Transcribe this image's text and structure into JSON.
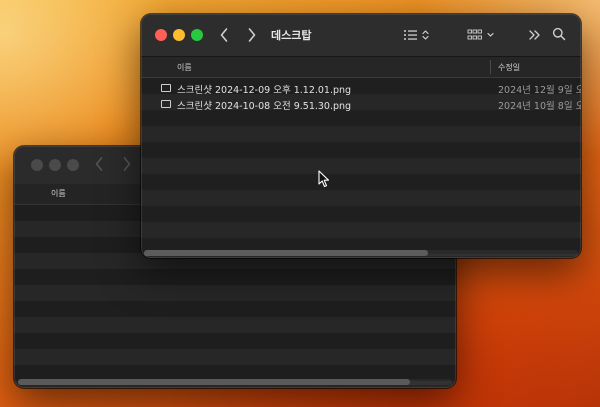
{
  "front_window": {
    "title": "데스크탑",
    "columns": {
      "name": "이름",
      "modified": "수정일"
    },
    "files": [
      {
        "name": "스크린샷 2024-12-09 오후 1.12.01.png",
        "date": "2024년 12월 9일 오"
      },
      {
        "name": "스크린샷 2024-10-08 오전 9.51.30.png",
        "date": "2024년 10월 8일 오"
      }
    ]
  },
  "back_window": {
    "columns": {
      "name": "이름"
    }
  },
  "icons": {
    "back": "chevron-left-icon",
    "forward": "chevron-right-icon",
    "list_view": "list-view-icon",
    "group": "group-view-icon",
    "more": "double-chevron-right-icon",
    "search": "search-icon",
    "cursor": "mouse-pointer-icon"
  },
  "colors": {
    "close": "#ff5f57",
    "minimize": "#febc2e",
    "zoom": "#28c840",
    "window_bg": "#222222"
  }
}
